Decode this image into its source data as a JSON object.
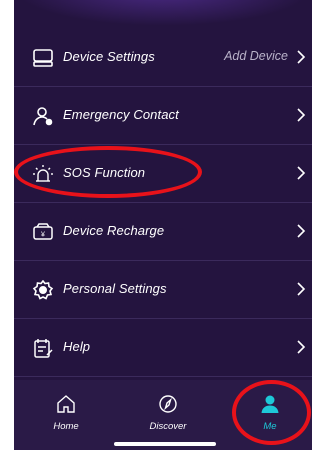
{
  "settings": {
    "items": [
      {
        "label": "Device Settings",
        "value": "Add Device",
        "icon": "device-icon"
      },
      {
        "label": "Emergency Contact",
        "value": "",
        "icon": "contact-person-icon"
      },
      {
        "label": "SOS Function",
        "value": "",
        "icon": "sos-light-icon"
      },
      {
        "label": "Device Recharge",
        "value": "",
        "icon": "recharge-card-icon"
      },
      {
        "label": "Personal Settings",
        "value": "",
        "icon": "settings-gear-icon"
      },
      {
        "label": "Help",
        "value": "",
        "icon": "help-doc-icon"
      }
    ]
  },
  "tabbar": {
    "tabs": [
      {
        "label": "Home",
        "icon": "home-icon",
        "active": false
      },
      {
        "label": "Discover",
        "icon": "compass-icon",
        "active": false
      },
      {
        "label": "Me",
        "icon": "person-icon",
        "active": true
      }
    ]
  },
  "colors": {
    "background": "#24143f",
    "tabbar": "#2a1a47",
    "active_tab": "#1ec9d8",
    "annotation": "#e8121a"
  }
}
